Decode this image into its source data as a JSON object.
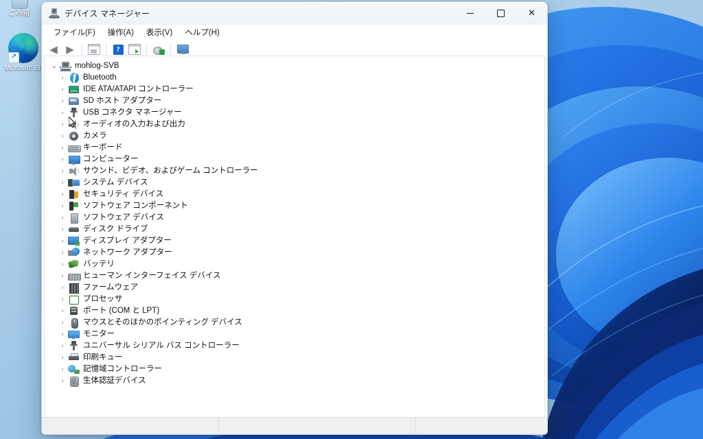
{
  "desktop": {
    "icons": [
      {
        "name": "recycle-bin",
        "label": "ごみ箱"
      },
      {
        "name": "microsoft-edge",
        "label": "Microsoft Ed"
      }
    ],
    "wallpaper_colors": {
      "sky_light": "#bcdcf2",
      "sky_mid": "#a6cbe8",
      "bloom_bright": "#2f86f5",
      "bloom_mid": "#1566d6",
      "bloom_dark": "#0b2f7a",
      "bloom_deep": "#06194a"
    }
  },
  "window": {
    "title": "デバイス マネージャー",
    "app_icon": "device-manager-icon",
    "controls": {
      "minimize": "—",
      "maximize": "□",
      "close": "✕"
    },
    "menu": [
      {
        "name": "file",
        "label": "ファイル(F)"
      },
      {
        "name": "action",
        "label": "操作(A)"
      },
      {
        "name": "view",
        "label": "表示(V)"
      },
      {
        "name": "help",
        "label": "ヘルプ(H)"
      }
    ],
    "toolbar": [
      {
        "name": "back-icon",
        "glyph": "◀"
      },
      {
        "name": "forward-icon",
        "glyph": "▶"
      },
      {
        "name": "properties-icon"
      },
      {
        "name": "help-icon",
        "glyph": "?"
      },
      {
        "name": "scan-for-hardware-changes-icon"
      },
      {
        "name": "update-driver-icon"
      },
      {
        "name": "show-hidden-devices-icon"
      }
    ],
    "statusbar": {
      "main": "",
      "pane_b": "",
      "pane_c": ""
    }
  },
  "tree": {
    "root": {
      "label": "mohlog-SVB",
      "icon": "computer-icon",
      "expanded": true
    },
    "items": [
      {
        "label": "Bluetooth",
        "icon": "bluetooth-icon"
      },
      {
        "label": "IDE ATA/ATAPI コントローラー",
        "icon": "ide-controller-icon"
      },
      {
        "label": "SD ホスト アダプター",
        "icon": "sd-host-adapter-icon"
      },
      {
        "label": "USB コネクタ マネージャー",
        "icon": "usb-connector-icon"
      },
      {
        "label": "オーディオの入力および出力",
        "icon": "audio-io-icon"
      },
      {
        "label": "カメラ",
        "icon": "camera-icon"
      },
      {
        "label": "キーボード",
        "icon": "keyboard-icon"
      },
      {
        "label": "コンピューター",
        "icon": "computer-device-icon"
      },
      {
        "label": "サウンド、ビデオ、およびゲーム コントローラー",
        "icon": "sound-video-game-icon"
      },
      {
        "label": "システム デバイス",
        "icon": "system-devices-icon"
      },
      {
        "label": "セキュリティ デバイス",
        "icon": "security-devices-icon"
      },
      {
        "label": "ソフトウェア コンポーネント",
        "icon": "software-components-icon"
      },
      {
        "label": "ソフトウェア デバイス",
        "icon": "software-devices-icon"
      },
      {
        "label": "ディスク ドライブ",
        "icon": "disk-drives-icon"
      },
      {
        "label": "ディスプレイ アダプター",
        "icon": "display-adapters-icon"
      },
      {
        "label": "ネットワーク アダプター",
        "icon": "network-adapters-icon"
      },
      {
        "label": "バッテリ",
        "icon": "batteries-icon"
      },
      {
        "label": "ヒューマン インターフェイス デバイス",
        "icon": "hid-icon"
      },
      {
        "label": "ファームウェア",
        "icon": "firmware-icon"
      },
      {
        "label": "プロセッサ",
        "icon": "processors-icon"
      },
      {
        "label": "ポート (COM と LPT)",
        "icon": "ports-icon"
      },
      {
        "label": "マウスとそのほかのポインティング デバイス",
        "icon": "mice-icon"
      },
      {
        "label": "モニター",
        "icon": "monitors-icon"
      },
      {
        "label": "ユニバーサル シリアル バス コントローラー",
        "icon": "usb-controllers-icon"
      },
      {
        "label": "印刷キュー",
        "icon": "print-queues-icon"
      },
      {
        "label": "記憶域コントローラー",
        "icon": "storage-controllers-icon"
      },
      {
        "label": "生体認証デバイス",
        "icon": "biometric-devices-icon"
      }
    ],
    "collapsed_glyph": "›",
    "expanded_glyph": "⌄"
  }
}
